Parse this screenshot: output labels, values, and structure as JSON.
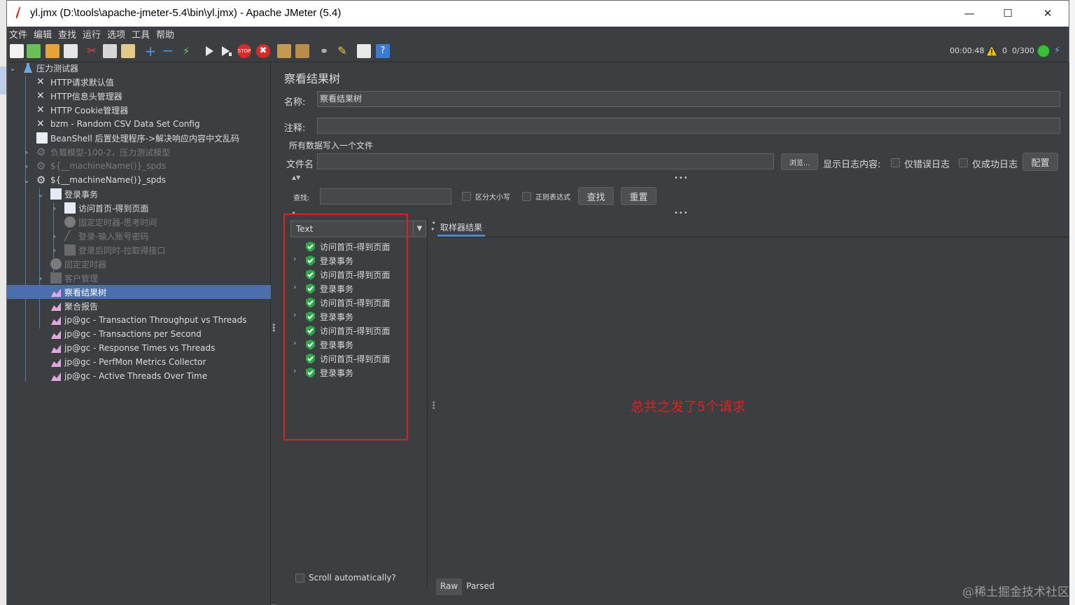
{
  "window": {
    "title": "yl.jmx (D:\\tools\\apache-jmeter-5.4\\bin\\yl.jmx) - Apache JMeter (5.4)",
    "minimize_icon": "minimize-icon",
    "maximize_icon": "maximize-icon",
    "close_icon": "close-icon"
  },
  "menu": [
    "文件",
    "编辑",
    "查找",
    "运行",
    "选项",
    "工具",
    "帮助"
  ],
  "toolbar": {
    "icons": [
      "new-icon",
      "templates-icon",
      "open-icon",
      "save-icon",
      "cut-icon",
      "copy-icon",
      "paste-icon",
      "expand-icon",
      "collapse-icon",
      "toggle-icon",
      "start-icon",
      "start-no-pause-icon",
      "stop-icon",
      "shutdown-icon",
      "clear-icon",
      "clear-all-icon",
      "search-icon",
      "reset-search-icon",
      "function-helper-icon",
      "help-icon"
    ],
    "elapsed": "00:00:48",
    "warnings": "0",
    "threads": "0/300"
  },
  "tree": [
    {
      "label": "压力测试器",
      "icon": "test-plan-icon",
      "expanded": true,
      "state": "normal"
    },
    {
      "label": "HTTP请求默认值",
      "icon": "config-icon",
      "state": "normal"
    },
    {
      "label": "HTTP信息头管理器",
      "icon": "config-icon",
      "state": "normal"
    },
    {
      "label": "HTTP Cookie管理器",
      "icon": "config-icon",
      "state": "normal"
    },
    {
      "label": "bzm - Random CSV Data Set Config",
      "icon": "config-icon",
      "state": "normal"
    },
    {
      "label": "BeanShell 后置处理程序->解决响应内容中文乱码",
      "icon": "postprocessor-icon",
      "state": "normal"
    },
    {
      "label": "负载模型-100-2，压力测试模型",
      "icon": "thread-group-icon",
      "state": "disabled",
      "collapsed": true
    },
    {
      "label": "${__machineName()}_spds",
      "icon": "thread-group-icon",
      "state": "disabled",
      "collapsed": true
    },
    {
      "label": "${__machineName()}_spds",
      "icon": "thread-group-icon",
      "state": "normal",
      "expanded": true
    },
    {
      "label": "登录事务",
      "icon": "transaction-icon",
      "state": "normal",
      "expanded": true
    },
    {
      "label": "访问首页-得到页面",
      "icon": "sampler-icon",
      "state": "normal",
      "collapsed": true
    },
    {
      "label": "固定定时器-思考时间",
      "icon": "timer-icon",
      "state": "disabled"
    },
    {
      "label": "登录-输入账号密码",
      "icon": "sampler-icon",
      "state": "disabled",
      "collapsed": true
    },
    {
      "label": "登录后同时-拉取得接口",
      "icon": "sampler-icon",
      "state": "disabled",
      "collapsed": true
    },
    {
      "label": "固定定时器",
      "icon": "timer-icon",
      "state": "disabled"
    },
    {
      "label": "客户管理",
      "icon": "transaction-icon",
      "state": "disabled",
      "collapsed": true
    },
    {
      "label": "察看结果树",
      "icon": "listener-icon",
      "state": "selected"
    },
    {
      "label": "聚合报告",
      "icon": "listener-icon",
      "state": "normal"
    },
    {
      "label": "jp@gc - Transaction Throughput vs Threads",
      "icon": "listener-icon",
      "state": "normal"
    },
    {
      "label": "jp@gc - Transactions per Second",
      "icon": "listener-icon",
      "state": "normal"
    },
    {
      "label": "jp@gc - Response Times vs Threads",
      "icon": "listener-icon",
      "state": "normal"
    },
    {
      "label": "jp@gc - PerfMon Metrics Collector",
      "icon": "listener-icon",
      "state": "normal"
    },
    {
      "label": "jp@gc - Active Threads Over Time",
      "icon": "listener-icon",
      "state": "normal"
    }
  ],
  "panel": {
    "heading": "察看结果树",
    "name_label": "名称:",
    "name_value": "察看结果树",
    "comment_label": "注释:",
    "comment_value": "",
    "write_all_label": "所有数据写入一个文件",
    "filename_label": "文件名",
    "filename_value": "",
    "browse_button": "浏览...",
    "log_content_label": "显示日志内容:",
    "errors_only": "仅错误日志",
    "success_only": "仅成功日志",
    "config_button": "配置",
    "search_label": "查找:",
    "search_value": "",
    "case_sensitive": "区分大小写",
    "regex": "正则表达式",
    "find_button": "查找",
    "reset_button": "重置",
    "renderer": "Text",
    "results": [
      {
        "label": "访问首页-得到页面",
        "expandable": false
      },
      {
        "label": "登录事务",
        "expandable": true
      },
      {
        "label": "访问首页-得到页面",
        "expandable": false
      },
      {
        "label": "登录事务",
        "expandable": true
      },
      {
        "label": "访问首页-得到页面",
        "expandable": false
      },
      {
        "label": "登录事务",
        "expandable": true
      },
      {
        "label": "访问首页-得到页面",
        "expandable": false
      },
      {
        "label": "登录事务",
        "expandable": true
      },
      {
        "label": "访问首页-得到页面",
        "expandable": false
      },
      {
        "label": "登录事务",
        "expandable": true
      }
    ],
    "scroll_auto": "Scroll automatically?",
    "sampler_tab": "取样器结果",
    "raw_tab": "Raw",
    "parsed_tab": "Parsed"
  },
  "annotation": "总共之发了5个请求",
  "watermark": "@稀土掘金技术社区",
  "colors": {
    "bg": "#3c3f41",
    "selection": "#4b6eaf",
    "annotation_red": "#e02020",
    "success_green": "#2fa84a"
  }
}
